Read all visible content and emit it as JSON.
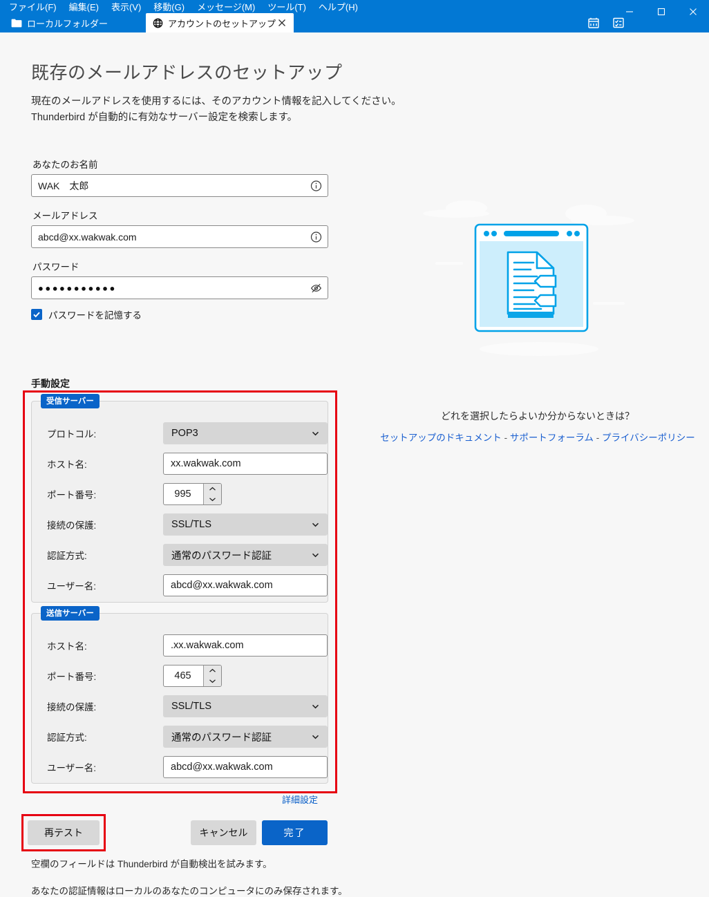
{
  "window": {
    "menus": [
      {
        "label": "ファイル(F)"
      },
      {
        "label": "編集(E)"
      },
      {
        "label": "表示(V)"
      },
      {
        "label": "移動(G)"
      },
      {
        "label": "メッセージ(M)"
      },
      {
        "label": "ツール(T)"
      },
      {
        "label": "ヘルプ(H)"
      }
    ],
    "accent_color": "#0278d4",
    "controls": {
      "minimize": "minimize-icon",
      "maximize": "maximize-icon",
      "close": "close-icon"
    },
    "toolbar_icons": [
      "calendar-icon",
      "tasks-icon"
    ]
  },
  "tabs": [
    {
      "label": "ローカルフォルダー",
      "icon": "folder-icon",
      "active": false,
      "closable": false
    },
    {
      "label": "アカウントのセットアップ",
      "icon": "globe-icon",
      "active": true,
      "closable": true
    }
  ],
  "page": {
    "title": "既存のメールアドレスのセットアップ",
    "intro_line1": "現在のメールアドレスを使用するには、そのアカウント情報を記入してください。",
    "intro_line2": "Thunderbird が自動的に有効なサーバー設定を検索します。"
  },
  "account_fields": {
    "name": {
      "label": "あなたのお名前",
      "value": "WAK　太郎",
      "icon": "info-icon"
    },
    "email": {
      "label": "メールアドレス",
      "value": "abcd@xx.wakwak.com",
      "icon": "info-icon"
    },
    "password": {
      "label": "パスワード",
      "value": "●●●●●●●●●●●",
      "icon": "eye-off-icon"
    },
    "remember": {
      "label": "パスワードを記憶する",
      "checked": true
    }
  },
  "manual": {
    "heading": "手動設定",
    "incoming": {
      "legend": "受信サーバー",
      "rows": [
        {
          "label": "プロトコル:",
          "type": "select",
          "value": "POP3"
        },
        {
          "label": "ホスト名:",
          "type": "text",
          "value": "xx.wakwak.com"
        },
        {
          "label": "ポート番号:",
          "type": "spinner",
          "value": "995"
        },
        {
          "label": "接続の保護:",
          "type": "select",
          "value": "SSL/TLS"
        },
        {
          "label": "認証方式:",
          "type": "select",
          "value": "通常のパスワード認証"
        },
        {
          "label": "ユーザー名:",
          "type": "text",
          "value": "abcd@xx.wakwak.com"
        }
      ]
    },
    "outgoing": {
      "legend": "送信サーバー",
      "rows": [
        {
          "label": "ホスト名:",
          "type": "text",
          "value": ".xx.wakwak.com"
        },
        {
          "label": "ポート番号:",
          "type": "spinner",
          "value": "465"
        },
        {
          "label": "接続の保護:",
          "type": "select",
          "value": "SSL/TLS"
        },
        {
          "label": "認証方式:",
          "type": "select",
          "value": "通常のパスワード認証"
        },
        {
          "label": "ユーザー名:",
          "type": "text",
          "value": "abcd@xx.wakwak.com"
        }
      ]
    },
    "advanced_link": "詳細設定",
    "highlight_color": "#e60012"
  },
  "actions": {
    "retest": "再テスト",
    "cancel": "キャンセル",
    "done": "完了",
    "note1": "空欄のフィールドは Thunderbird が自動検出を試みます。",
    "note2": "あなたの認証情報はローカルのあなたのコンピュータにのみ保存されます。"
  },
  "help": {
    "question": "どれを選択したらよいか分からないときは？",
    "links": [
      {
        "label": "セットアップのドキュメント"
      },
      {
        "label": "サポートフォーラム"
      },
      {
        "label": "プライバシーポリシー"
      }
    ],
    "separator": "-",
    "link_color": "#1a5fd0"
  }
}
